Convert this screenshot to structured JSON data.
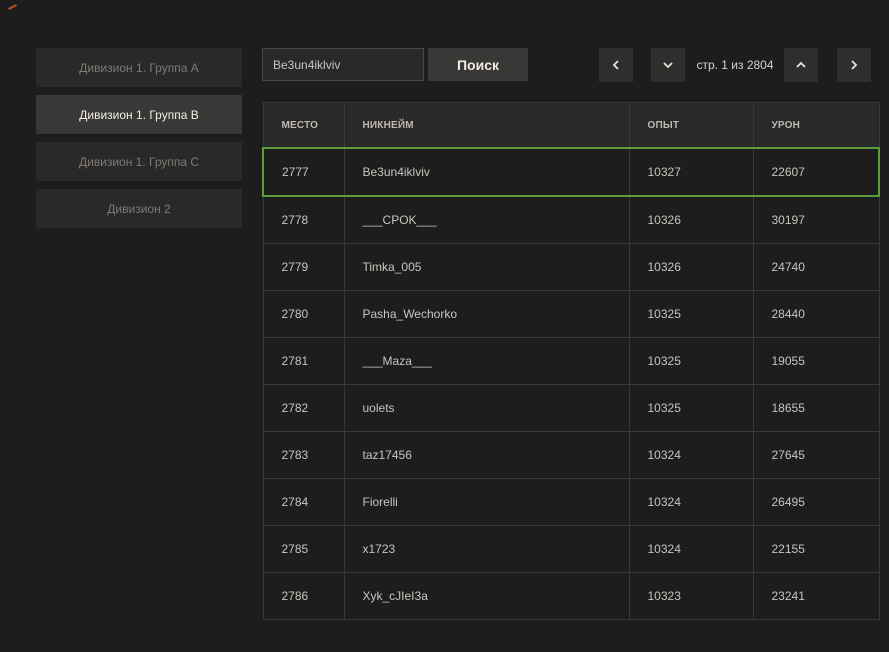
{
  "sidebar": {
    "items": [
      {
        "label": "Дивизион 1. Группа A",
        "active": false
      },
      {
        "label": "Дивизион 1. Группа B",
        "active": true
      },
      {
        "label": "Дивизион 1. Группа C",
        "active": false
      },
      {
        "label": "Дивизион 2",
        "active": false
      }
    ]
  },
  "search": {
    "value": "Be3un4iklviv",
    "button_label": "Поиск"
  },
  "pagination": {
    "page_label": "стр. 1 из 2804",
    "current_page": 1,
    "total_pages": 2804
  },
  "table": {
    "headers": [
      "МЕСТО",
      "НИКНЕЙМ",
      "ОПЫТ",
      "УРОН"
    ],
    "highlight_rank": "2777",
    "highlight_color": "#5c9e3c",
    "rows": [
      [
        "2777",
        "Be3un4iklviv",
        "10327",
        "22607"
      ],
      [
        "2778",
        "___CPOK___",
        "10326",
        "30197"
      ],
      [
        "2779",
        "Timka_005",
        "10326",
        "24740"
      ],
      [
        "2780",
        "Pasha_Wechorko",
        "10325",
        "28440"
      ],
      [
        "2781",
        "___Maza___",
        "10325",
        "19055"
      ],
      [
        "2782",
        "uolets",
        "10325",
        "18655"
      ],
      [
        "2783",
        "taz17456",
        "10324",
        "27645"
      ],
      [
        "2784",
        "Fiorelli",
        "10324",
        "26495"
      ],
      [
        "2785",
        "x1723",
        "10324",
        "22155"
      ],
      [
        "2786",
        "Xyk_cJIeI3a",
        "10323",
        "23241"
      ]
    ]
  }
}
